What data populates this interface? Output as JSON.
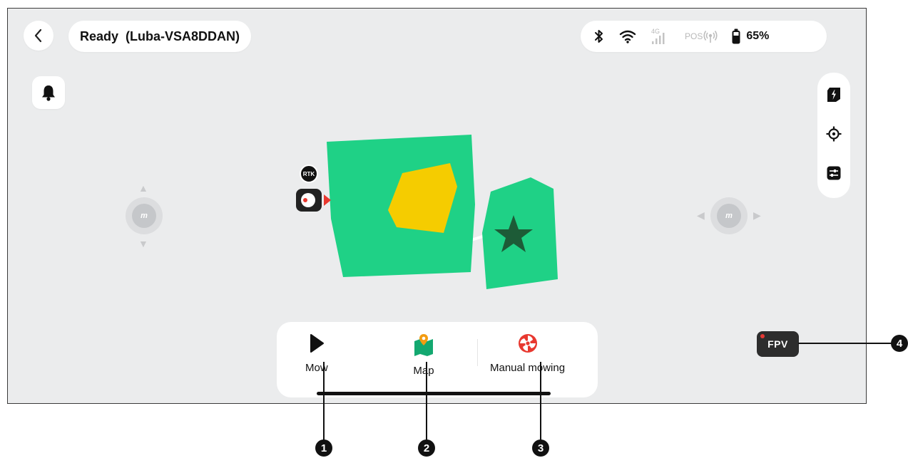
{
  "header": {
    "status": "Ready",
    "device": "(Luba-VSA8DDAN)"
  },
  "system": {
    "network_label": "4G",
    "pos_label": "POS",
    "battery": "65%"
  },
  "map": {
    "rtk_label": "RTK"
  },
  "joysticks": {
    "knob_label": "m"
  },
  "actions": {
    "mow": "Mow",
    "map": "Map",
    "manual": "Manual mowing"
  },
  "fpv": {
    "label": "FPV"
  },
  "callouts": [
    "1",
    "2",
    "3",
    "4"
  ],
  "colors": {
    "zone": "#1fd186",
    "zone_inner": "#f5cc00",
    "star": "#1d5b37",
    "accent_red": "#e8382f",
    "map_icon": "#13a870",
    "pin": "#f39c12"
  }
}
